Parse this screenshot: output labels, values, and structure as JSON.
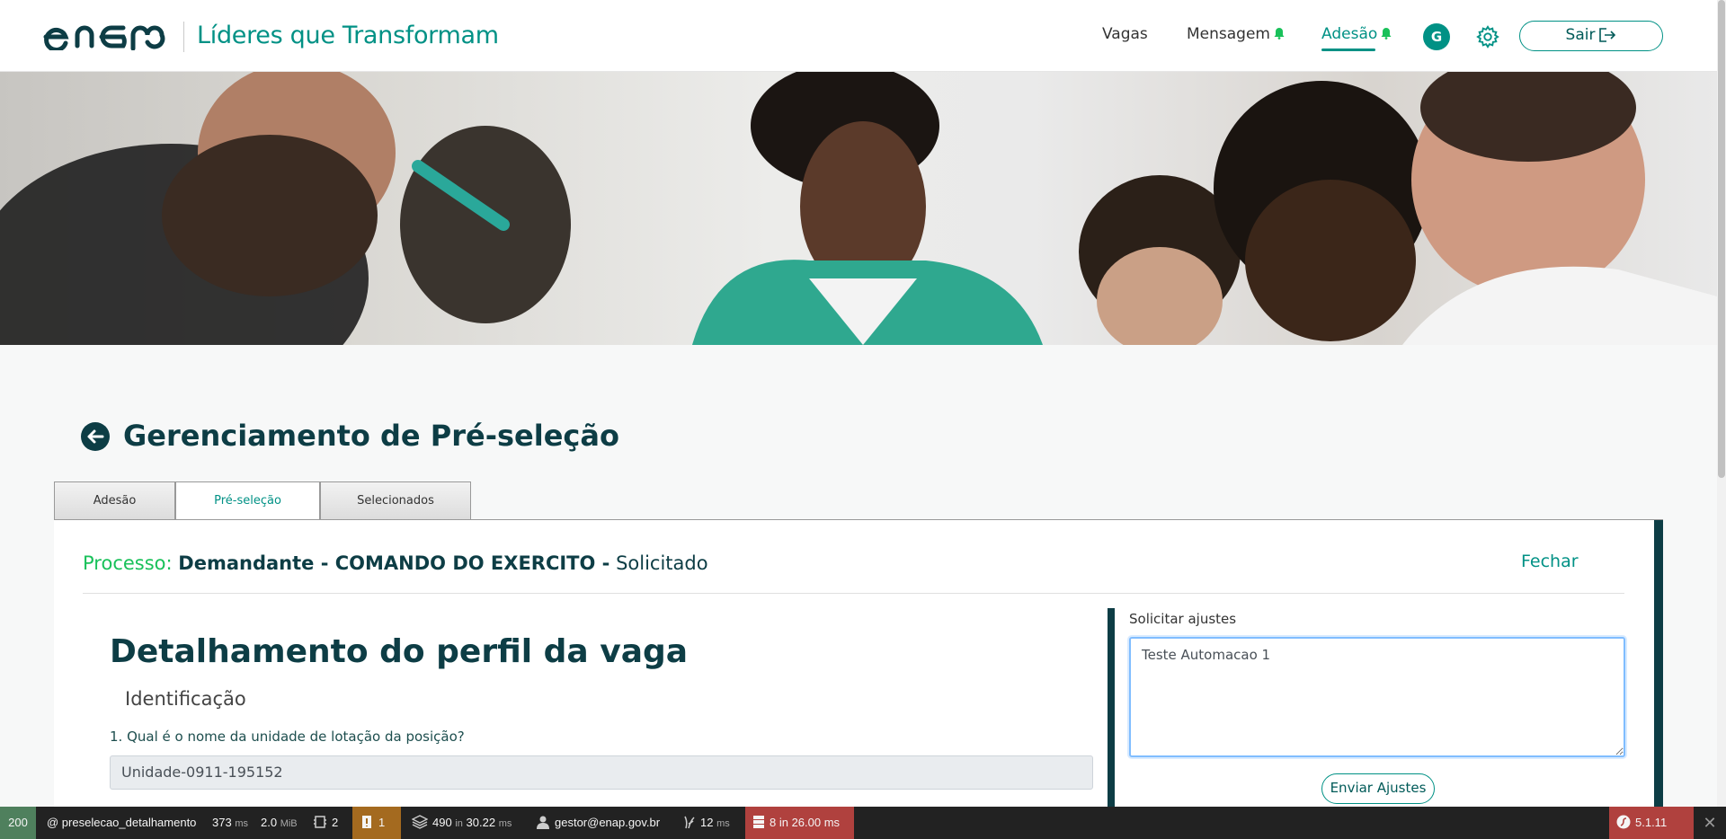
{
  "header": {
    "brand_title": "Líderes que Transformam",
    "nav": {
      "vagas": "Vagas",
      "mensagem": "Mensagem",
      "adesao": "Adesão"
    },
    "avatar_initial": "G",
    "logout_label": "Sair",
    "accent_color": "#009185",
    "bell_color": "#19c15a"
  },
  "page": {
    "title": "Gerenciamento de Pré-seleção",
    "tabs": [
      {
        "label": "Adesão",
        "active": false
      },
      {
        "label": "Pré-seleção",
        "active": true
      },
      {
        "label": "Selecionados",
        "active": false
      }
    ]
  },
  "process": {
    "label": "Processo:",
    "name": "Demandante - COMANDO DO EXERCITO -",
    "status": "Solicitado",
    "close_label": "Fechar"
  },
  "detail": {
    "title": "Detalhamento do perfil da vaga",
    "section": "Identificação",
    "question_1": "1. Qual é o nome da unidade de lotação da posição?",
    "answer_1": "Unidade-0911-195152"
  },
  "adjustments": {
    "label": "Solicitar ajustes",
    "text": "Teste Automacao 1",
    "submit_label": "Enviar Ajustes"
  },
  "debug_toolbar": {
    "status_code": "200",
    "route": "@ preselecao_detalhamento",
    "time_value": "373",
    "time_unit": "ms",
    "memory_value": "2.0",
    "memory_unit": "MiB",
    "forms_count": "2",
    "logs_count": "1",
    "doctrine_count": "490",
    "doctrine_in": "in",
    "doctrine_time": "30.22",
    "doctrine_unit": "ms",
    "user": "gestor@enap.gov.br",
    "twig_time": "12",
    "twig_unit": "ms",
    "db_summary": "8 in 26.00 ms",
    "version": "5.1.11"
  }
}
